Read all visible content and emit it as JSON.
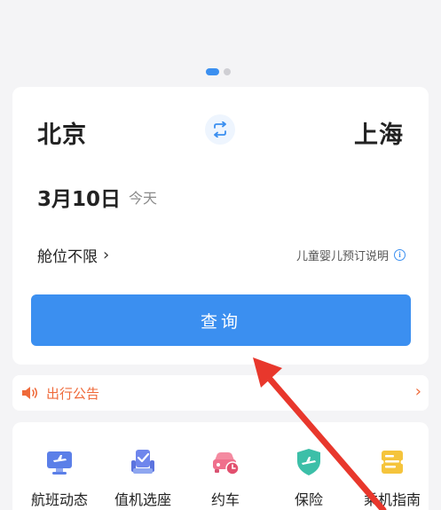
{
  "carousel": {
    "count": 2,
    "active": 0
  },
  "route": {
    "from_city": "北京",
    "to_city": "上海"
  },
  "date": {
    "value": "3月10日",
    "label": "今天"
  },
  "cabin": {
    "label": "舱位不限"
  },
  "child_note": {
    "label": "儿童婴儿预订说明"
  },
  "query_button": {
    "label": "查询"
  },
  "notice": {
    "label": "出行公告"
  },
  "services": [
    {
      "label": "航班动态",
      "icon": "monitor-plane-icon"
    },
    {
      "label": "值机选座",
      "icon": "seat-check-icon"
    },
    {
      "label": "约车",
      "icon": "car-clock-icon"
    },
    {
      "label": "保险",
      "icon": "shield-plane-icon"
    },
    {
      "label": "乘机指南",
      "icon": "ticket-guide-icon"
    }
  ],
  "colors": {
    "accent": "#3b8ff0",
    "notice": "#ef6a3a",
    "arrow": "#e8372c"
  }
}
